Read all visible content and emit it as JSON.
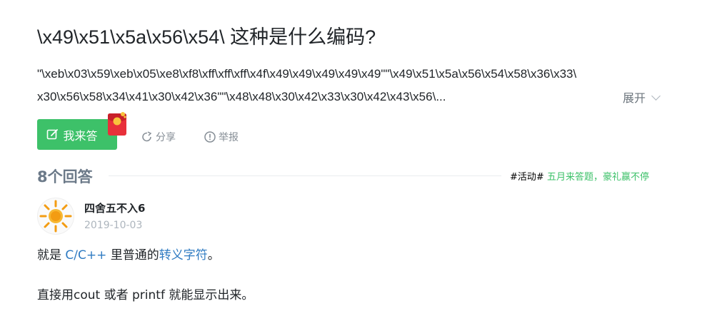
{
  "question": {
    "title": "\\x49\\x51\\x5a\\x56\\x54\\ 这种是什么编码?",
    "body_lines": [
      "\"\\xeb\\x03\\x59\\xeb\\x05\\xe8\\xf8\\xff\\xff\\xff\\x4f\\x49\\x49\\x49\\x49\\x49\"\"\\x49\\x51\\x5a\\x56\\x54\\x58\\x36\\x33\\",
      "x30\\x56\\x58\\x34\\x41\\x30\\x42\\x36\"\"\\x48\\x48\\x30\\x42\\x33\\x30\\x42\\x43\\x56\\..."
    ],
    "expand_label": "展开"
  },
  "actions": {
    "answer_label": "我来答",
    "share_label": "分享",
    "report_label": "举报"
  },
  "answers_header": {
    "count_label": "8个回答",
    "activity_tag": "#活动#",
    "activity_text": "五月来答题，豪礼赢不停"
  },
  "answer": {
    "username": "四舍五不入6",
    "date": "2019-10-03",
    "p1_prefix": "就是 ",
    "p1_link1": "C/C++",
    "p1_middle": " 里普通的",
    "p1_link2": "转义字符",
    "p1_suffix": "。",
    "p2": "直接用cout 或者 printf 就能显示出来。"
  },
  "colors": {
    "accent_green": "#3dc169",
    "link_blue": "#2f7bc2"
  }
}
